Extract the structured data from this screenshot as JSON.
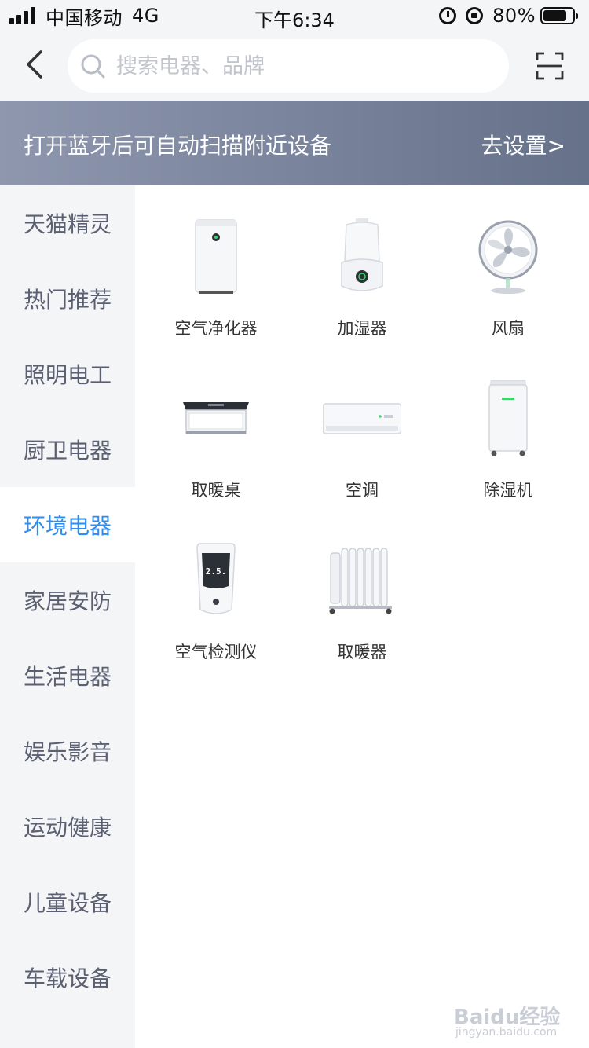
{
  "status_bar": {
    "carrier": "中国移动",
    "network": "4G",
    "time": "下午6:34",
    "battery": "80%",
    "battery_level": 0.8
  },
  "search": {
    "placeholder": "搜索电器、品牌"
  },
  "banner": {
    "text": "打开蓝牙后可自动扫描附近设备",
    "link": "去设置>"
  },
  "sidebar": {
    "items": [
      {
        "label": "天猫精灵"
      },
      {
        "label": "热门推荐"
      },
      {
        "label": "照明电工"
      },
      {
        "label": "厨卫电器"
      },
      {
        "label": "环境电器",
        "active": true
      },
      {
        "label": "家居安防"
      },
      {
        "label": "生活电器"
      },
      {
        "label": "娱乐影音"
      },
      {
        "label": "运动健康"
      },
      {
        "label": "儿童设备"
      },
      {
        "label": "车载设备"
      }
    ]
  },
  "devices": [
    {
      "label": "空气净化器",
      "icon": "air-purifier-icon"
    },
    {
      "label": "加湿器",
      "icon": "humidifier-icon"
    },
    {
      "label": "风扇",
      "icon": "fan-icon"
    },
    {
      "label": "取暖桌",
      "icon": "heating-table-icon"
    },
    {
      "label": "空调",
      "icon": "air-conditioner-icon"
    },
    {
      "label": "除湿机",
      "icon": "dehumidifier-icon"
    },
    {
      "label": "空气检测仪",
      "icon": "air-monitor-icon"
    },
    {
      "label": "取暖器",
      "icon": "heater-icon"
    }
  ],
  "monitor_reading": "2.5.",
  "watermark": {
    "brand": "Baidu经验",
    "url": "jingyan.baidu.com"
  },
  "colors": {
    "accent": "#2e8bf0",
    "sidebar_bg": "#f4f5f7",
    "banner_start": "#8e97ae",
    "banner_end": "#66718a",
    "indicator_green": "#3fd46b"
  }
}
